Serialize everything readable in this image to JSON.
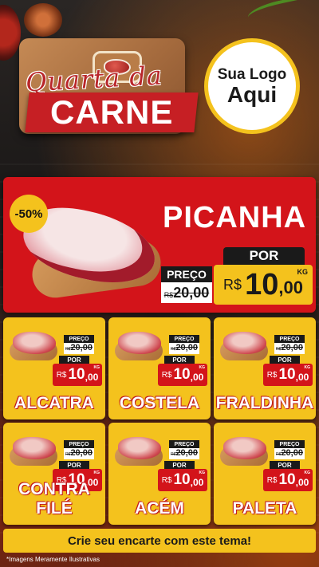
{
  "header": {
    "title_script": "Quarta da",
    "title_main": "CARNE",
    "logo_line1": "Sua Logo",
    "logo_line2": "Aqui"
  },
  "hero": {
    "discount": "-50%",
    "name": "PICANHA",
    "preco_label": "PREÇO",
    "old_currency": "R$",
    "old_price": "20,00",
    "por_label": "POR",
    "new_currency": "R$",
    "new_price_int": "10",
    "new_price_dec": ",00",
    "unit": "KG"
  },
  "products": [
    {
      "name": "ALCATRA",
      "preco_label": "PREÇO",
      "old_currency": "R$",
      "old_price": "20,00",
      "por_label": "POR",
      "new_currency": "R$",
      "new_price_int": "10",
      "new_price_dec": ",00",
      "unit": "KG"
    },
    {
      "name": "COSTELA",
      "preco_label": "PREÇO",
      "old_currency": "R$",
      "old_price": "20,00",
      "por_label": "POR",
      "new_currency": "R$",
      "new_price_int": "10",
      "new_price_dec": ",00",
      "unit": "KG"
    },
    {
      "name": "FRALDINHA",
      "preco_label": "PREÇO",
      "old_currency": "R$",
      "old_price": "20,00",
      "por_label": "POR",
      "new_currency": "R$",
      "new_price_int": "10",
      "new_price_dec": ",00",
      "unit": "KG"
    },
    {
      "name": "CONTRA FILÉ",
      "preco_label": "PREÇO",
      "old_currency": "R$",
      "old_price": "20,00",
      "por_label": "POR",
      "new_currency": "R$",
      "new_price_int": "10",
      "new_price_dec": ",00",
      "unit": "KG"
    },
    {
      "name": "ACÉM",
      "preco_label": "PREÇO",
      "old_currency": "R$",
      "old_price": "20,00",
      "por_label": "POR",
      "new_currency": "R$",
      "new_price_int": "10",
      "new_price_dec": ",00",
      "unit": "KG"
    },
    {
      "name": "PALETA",
      "preco_label": "PREÇO",
      "old_currency": "R$",
      "old_price": "20,00",
      "por_label": "POR",
      "new_currency": "R$",
      "new_price_int": "10",
      "new_price_dec": ",00",
      "unit": "KG"
    }
  ],
  "footer": {
    "cta": "Crie seu encarte com este tema!",
    "disclaimer": "*Imagens Meramente Ilustrativas"
  },
  "colors": {
    "red": "#d3141a",
    "yellow": "#f4c21d",
    "dark": "#1a1a1a"
  },
  "icons": [
    "steak-icon",
    "meat-image",
    "cutting-board"
  ]
}
